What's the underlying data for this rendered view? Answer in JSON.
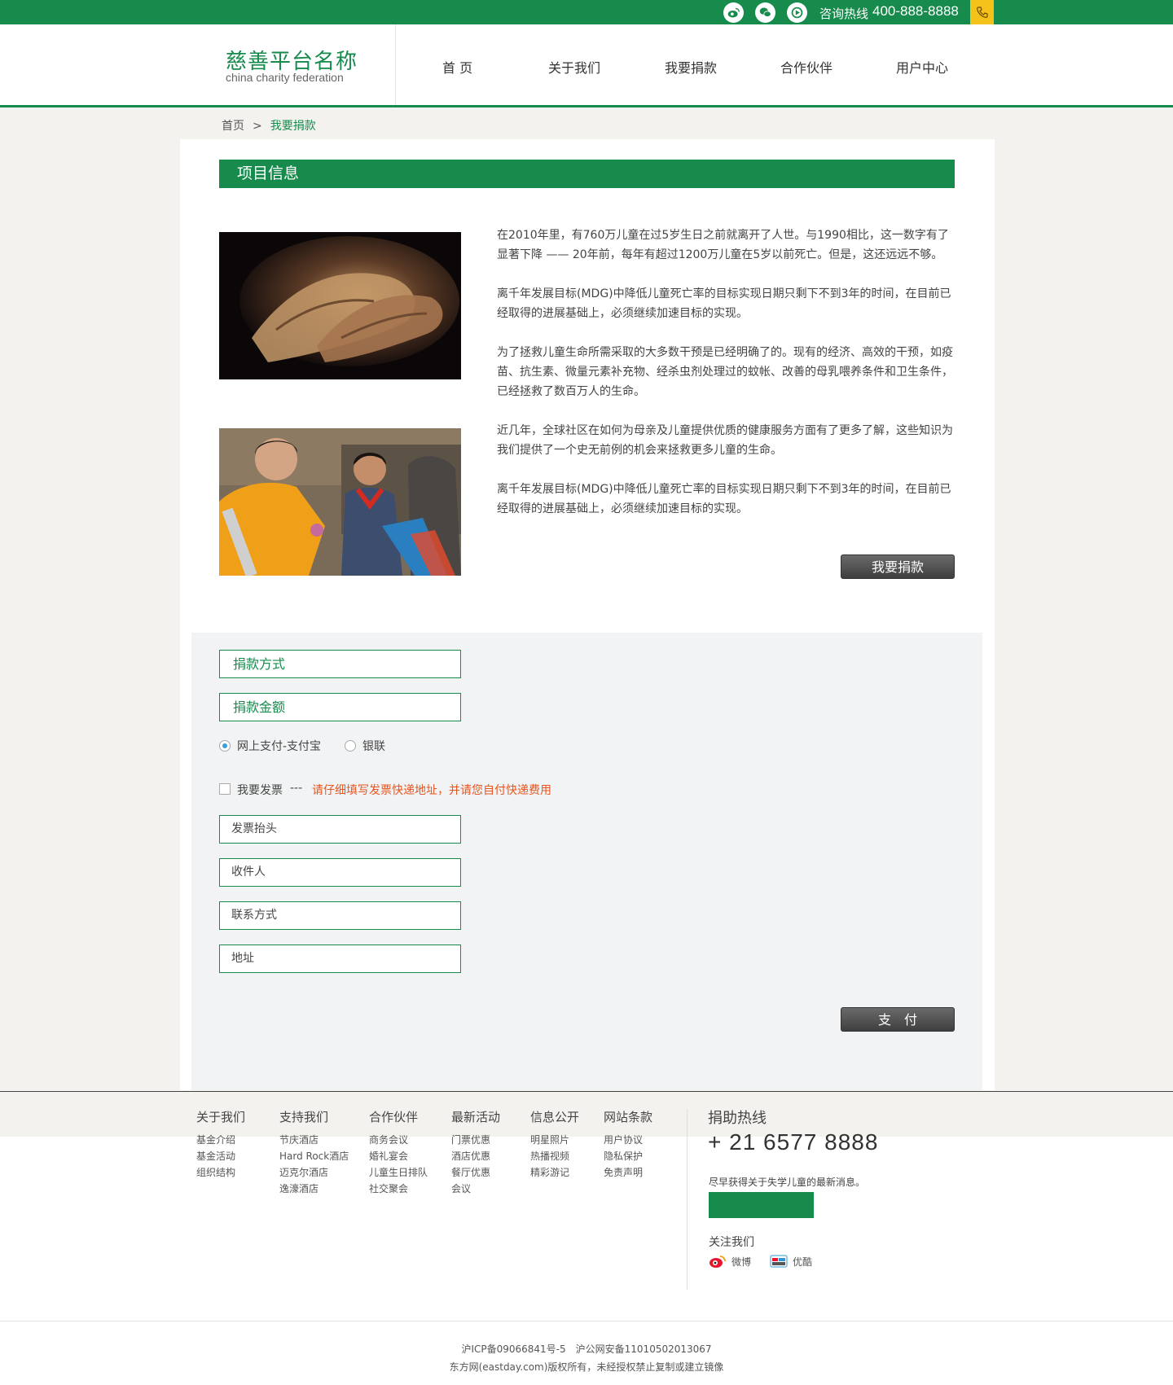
{
  "topbar": {
    "hotline_label": "咨询热线",
    "hotline_number": "400-888-8888",
    "social_icons": [
      "weibo-icon",
      "wechat-icon",
      "video-icon"
    ],
    "accent_color": "#168b4c",
    "phone_box_color": "#f5c21b"
  },
  "header": {
    "logo_cn": "慈善平台名称",
    "logo_en": "china charity federation",
    "nav": [
      "首 页",
      "关于我们",
      "我要捐款",
      "合作伙伴",
      "用户中心"
    ]
  },
  "breadcrumb": {
    "home": "首页",
    "separator": ">",
    "current": "我要捐款"
  },
  "project": {
    "title": "项目信息",
    "paragraphs": [
      "在2010年里，有760万儿童在过5岁生日之前就离开了人世。与1990相比，这一数字有了显著下降 —— 20年前，每年有超过1200万儿童在5岁以前死亡。但是，这还远远不够。",
      "离千年发展目标(MDG)中降低儿童死亡率的目标实现日期只剩下不到3年的时间，在目前已经取得的进展基础上，必须继续加速目标的实现。",
      "为了拯救儿童生命所需采取的大多数干预是已经明确了的。现有的经济、高效的干预，如疫苗、抗生素、微量元素补充物、经杀虫剂处理过的蚊帐、改善的母乳喂养条件和卫生条件，已经拯救了数百万人的生命。",
      "近几年，全球社区在如何为母亲及儿童提供优质的健康服务方面有了更多了解，这些知识为我们提供了一个史无前例的机会来拯救更多儿童的生命。",
      "离千年发展目标(MDG)中降低儿童死亡率的目标实现日期只剩下不到3年的时间，在目前已经取得的进展基础上，必须继续加速目标的实现。"
    ],
    "donate_button": "我要捐款"
  },
  "form": {
    "method_label": "捐款方式",
    "amount_label": "捐款金额",
    "payment_options": [
      {
        "label": "网上支付-支付宝",
        "checked": true
      },
      {
        "label": "银联",
        "checked": false
      }
    ],
    "invoice_label": "我要发票",
    "invoice_dash": "---",
    "invoice_note": "请仔细填写发票快递地址，并请您自付快递费用",
    "invoice_fields": [
      "发票抬头",
      "收件人",
      "联系方式",
      "地址"
    ],
    "pay_button": "支　付"
  },
  "footer": {
    "columns": [
      {
        "title": "关于我们",
        "links": [
          "基金介绍",
          "基金活动",
          "组织结构"
        ]
      },
      {
        "title": "支持我们",
        "links": [
          "节庆酒店",
          "Hard Rock酒店",
          "迈克尔酒店",
          "逸濠酒店"
        ]
      },
      {
        "title": "合作伙伴",
        "links": [
          "商务会议",
          "婚礼宴会",
          "儿童生日排队",
          "社交聚会"
        ]
      },
      {
        "title": "最新活动",
        "links": [
          "门票优惠",
          "酒店优惠",
          "餐厅优惠",
          "会议"
        ]
      },
      {
        "title": "信息公开",
        "links": [
          "明星照片",
          "热播视频",
          "精彩游记"
        ]
      },
      {
        "title": "网站条款",
        "links": [
          "用户协议",
          "隐私保护",
          "免责声明"
        ]
      }
    ],
    "donate_hotline_title": "捐助热线",
    "donate_hotline_number": "+ 21 6577 8888",
    "subscribe_text": "尽早获得关于失学儿童的最新消息。",
    "follow_label": "关注我们",
    "follow": [
      {
        "icon": "weibo-icon",
        "label": "微博"
      },
      {
        "icon": "youku-icon",
        "label": "优酷"
      }
    ],
    "icp": "沪ICP备09066841号-5　沪公网安备11010502013067",
    "copyright": "东方网(eastday.com)版权所有，未经授权禁止复制或建立镜像"
  }
}
